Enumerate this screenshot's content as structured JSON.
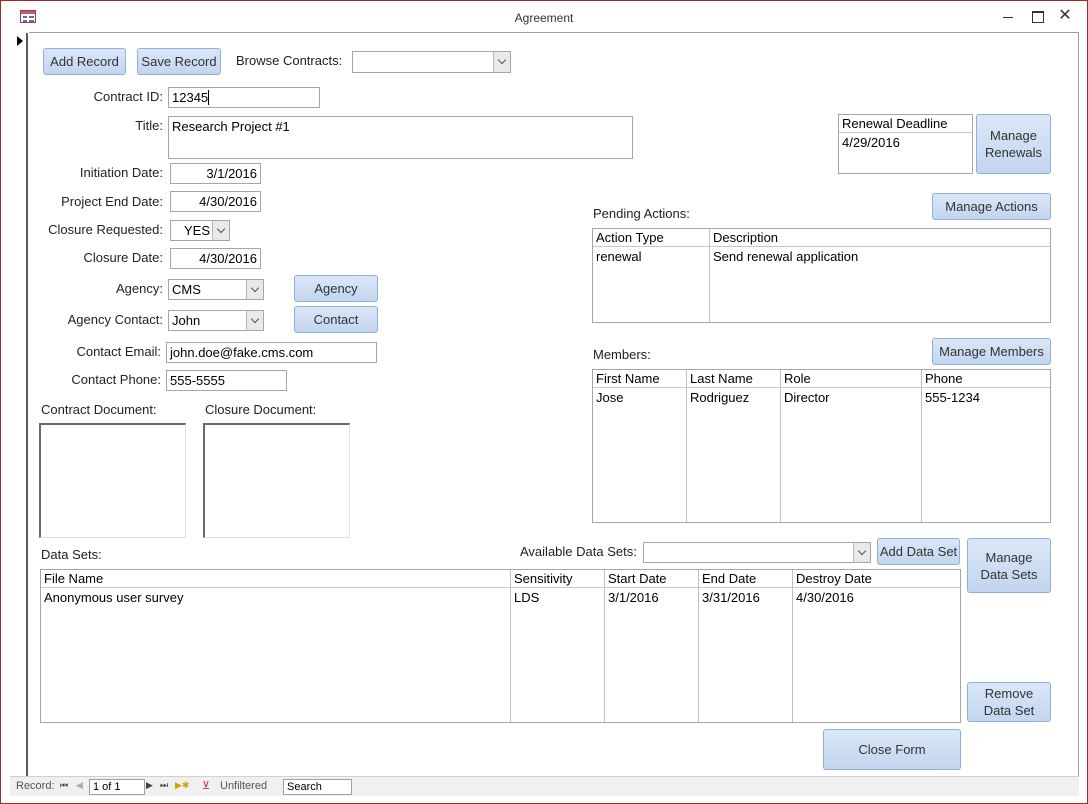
{
  "window": {
    "title": "Agreement",
    "controls": {
      "minimize": "–",
      "maximize": "☐",
      "close": "✕"
    }
  },
  "toolbar": {
    "add_record": "Add Record",
    "save_record": "Save Record",
    "browse_label": "Browse Contracts:",
    "browse_value": ""
  },
  "fields": {
    "contract_id": {
      "label": "Contract ID:",
      "value": "12345"
    },
    "title": {
      "label": "Title:",
      "value": "Research Project #1"
    },
    "initiation_date": {
      "label": "Initiation Date:",
      "value": "3/1/2016"
    },
    "project_end_date": {
      "label": "Project End Date:",
      "value": "4/30/2016"
    },
    "closure_requested": {
      "label": "Closure Requested:",
      "value": "YES"
    },
    "closure_date": {
      "label": "Closure Date:",
      "value": "4/30/2016"
    },
    "agency": {
      "label": "Agency:",
      "value": "CMS",
      "button": "Agency"
    },
    "agency_contact": {
      "label": "Agency Contact:",
      "value": "John",
      "button": "Contact"
    },
    "contact_email": {
      "label": "Contact Email:",
      "value": "john.doe@fake.cms.com"
    },
    "contact_phone": {
      "label": "Contact Phone:",
      "value": "555-5555"
    }
  },
  "documents": {
    "contract_label": "Contract Document:",
    "closure_label": "Closure Document:"
  },
  "renewal": {
    "header": "Renewal Deadline",
    "value": "4/29/2016",
    "button_line1": "Manage",
    "button_line2": "Renewals"
  },
  "pending_actions": {
    "label": "Pending Actions:",
    "button": "Manage Actions",
    "columns": [
      "Action Type",
      "Description"
    ],
    "rows": [
      [
        "renewal",
        "Send renewal application"
      ]
    ]
  },
  "members": {
    "label": "Members:",
    "button": "Manage Members",
    "columns": [
      "First Name",
      "Last Name",
      "Role",
      "Phone"
    ],
    "rows": [
      [
        "Jose",
        "Rodriguez",
        "Director",
        "555-1234"
      ]
    ]
  },
  "data_sets": {
    "label": "Data Sets:",
    "available_label": "Available Data Sets:",
    "available_value": "",
    "add_button": "Add Data Set",
    "manage_line1": "Manage",
    "manage_line2": "Data Sets",
    "remove_line1": "Remove",
    "remove_line2": "Data Set",
    "columns": [
      "File Name",
      "Sensitivity",
      "Start Date",
      "End Date",
      "Destroy Date"
    ],
    "rows": [
      [
        "Anonymous user survey",
        "LDS",
        "3/1/2016",
        "3/31/2016",
        "4/30/2016"
      ]
    ]
  },
  "close_form": "Close Form",
  "navigation": {
    "record_label": "Record:",
    "position": "1 of 1",
    "filter_status": "Unfiltered",
    "search_placeholder": "Search"
  }
}
